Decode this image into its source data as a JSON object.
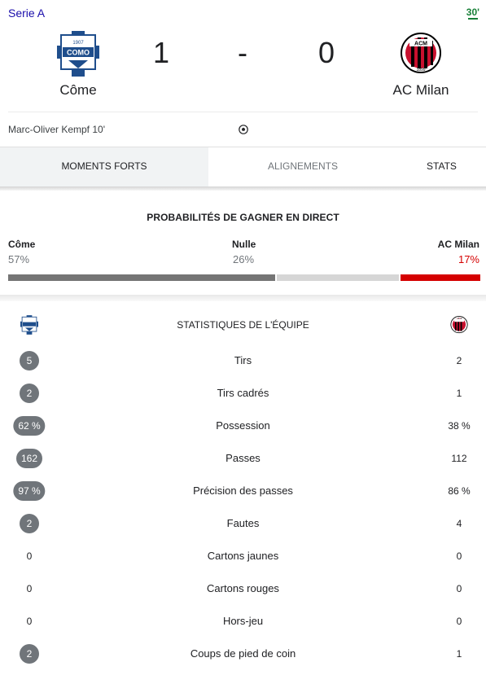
{
  "match": {
    "league": "Serie A",
    "minute": "30'",
    "home_team": "Côme",
    "away_team": "AC Milan",
    "home_score": "1",
    "separator": "-",
    "away_score": "0",
    "home_logo_text": "COMO",
    "home_logo_year": "1907",
    "away_logo_text": "ACM",
    "away_logo_year": "1899"
  },
  "events": {
    "scorer": "Marc-Oliver Kempf 10'",
    "icon": "soccer-ball-icon"
  },
  "tabs": [
    "MOMENTS FORTS",
    "ALIGNEMENTS",
    "STATS"
  ],
  "win_probability": {
    "title": "PROBABILITÉS DE GAGNER EN DIRECT",
    "home_label": "Côme",
    "draw_label": "Nulle",
    "away_label": "AC Milan",
    "home_pct": "57%",
    "draw_pct": "26%",
    "away_pct": "17%",
    "home_value": 57,
    "draw_value": 26,
    "away_value": 17,
    "colors": {
      "home": "#757575",
      "draw": "#d6d6d6",
      "away": "#d50000"
    }
  },
  "team_stats": {
    "title": "STATISTIQUES DE L'ÉQUIPE",
    "rows": [
      {
        "home": "5",
        "label": "Tirs",
        "away": "2",
        "home_leads": true
      },
      {
        "home": "2",
        "label": "Tirs cadrés",
        "away": "1",
        "home_leads": true
      },
      {
        "home": "62 %",
        "label": "Possession",
        "away": "38 %",
        "home_leads": true
      },
      {
        "home": "162",
        "label": "Passes",
        "away": "112",
        "home_leads": true
      },
      {
        "home": "97 %",
        "label": "Précision des passes",
        "away": "86 %",
        "home_leads": true
      },
      {
        "home": "2",
        "label": "Fautes",
        "away": "4",
        "home_leads": true
      },
      {
        "home": "0",
        "label": "Cartons jaunes",
        "away": "0",
        "home_leads": false
      },
      {
        "home": "0",
        "label": "Cartons rouges",
        "away": "0",
        "home_leads": false
      },
      {
        "home": "0",
        "label": "Hors-jeu",
        "away": "0",
        "home_leads": false
      },
      {
        "home": "2",
        "label": "Coups de pied de coin",
        "away": "1",
        "home_leads": true
      }
    ]
  }
}
